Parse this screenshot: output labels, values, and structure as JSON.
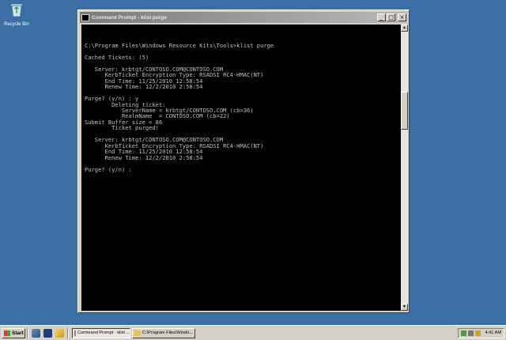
{
  "desktop": {
    "recycle_bin_label": "Recycle Bin"
  },
  "window": {
    "title": "Command Prompt - klist purge",
    "minimize_glyph": "_",
    "maximize_glyph": "□",
    "close_glyph": "×",
    "console_text": "C:\\Program Files\\Windows Resource Kits\\Tools>klist purge\n\nCached Tickets: (5)\n\n   Server: krbtgt/CONTOSO.COM@CONTOSO.COM\n      KerbTicket Encryption Type: RSADSI RC4-HMAC(NT)\n      End Time: 11/25/2010 12:58:54\n      Renew Time: 12/2/2010 2:58:54\n\nPurge? (y/n) : y\n        Deleting ticket:\n           ServerName = krbtgt/CONTOSO.COM (cb=36)\n           RealmName  = CONTOSO.COM (cb=22)\nSubmit Buffer size = 86\n        Ticket purged!\n\n   Server: krbtgt/CONTOSO.COM@CONTOSO.COM\n      KerbTicket Encryption Type: RSADSI RC4-HMAC(NT)\n      End Time: 11/25/2010 12:58:54\n      Renew Time: 12/2/2010 2:58:54\n\nPurge? (y/n) :"
  },
  "taskbar": {
    "start_label": "Start",
    "tasks": [
      {
        "label": "Command Prompt - klist ..."
      },
      {
        "label": "C:\\Program Files\\Windo..."
      }
    ],
    "clock": "4:41 AM"
  },
  "colors": {
    "desktop": "#3a6ea5",
    "console_bg": "#000000",
    "console_fg": "#c0c0c0",
    "chrome": "#d4d0c8"
  }
}
